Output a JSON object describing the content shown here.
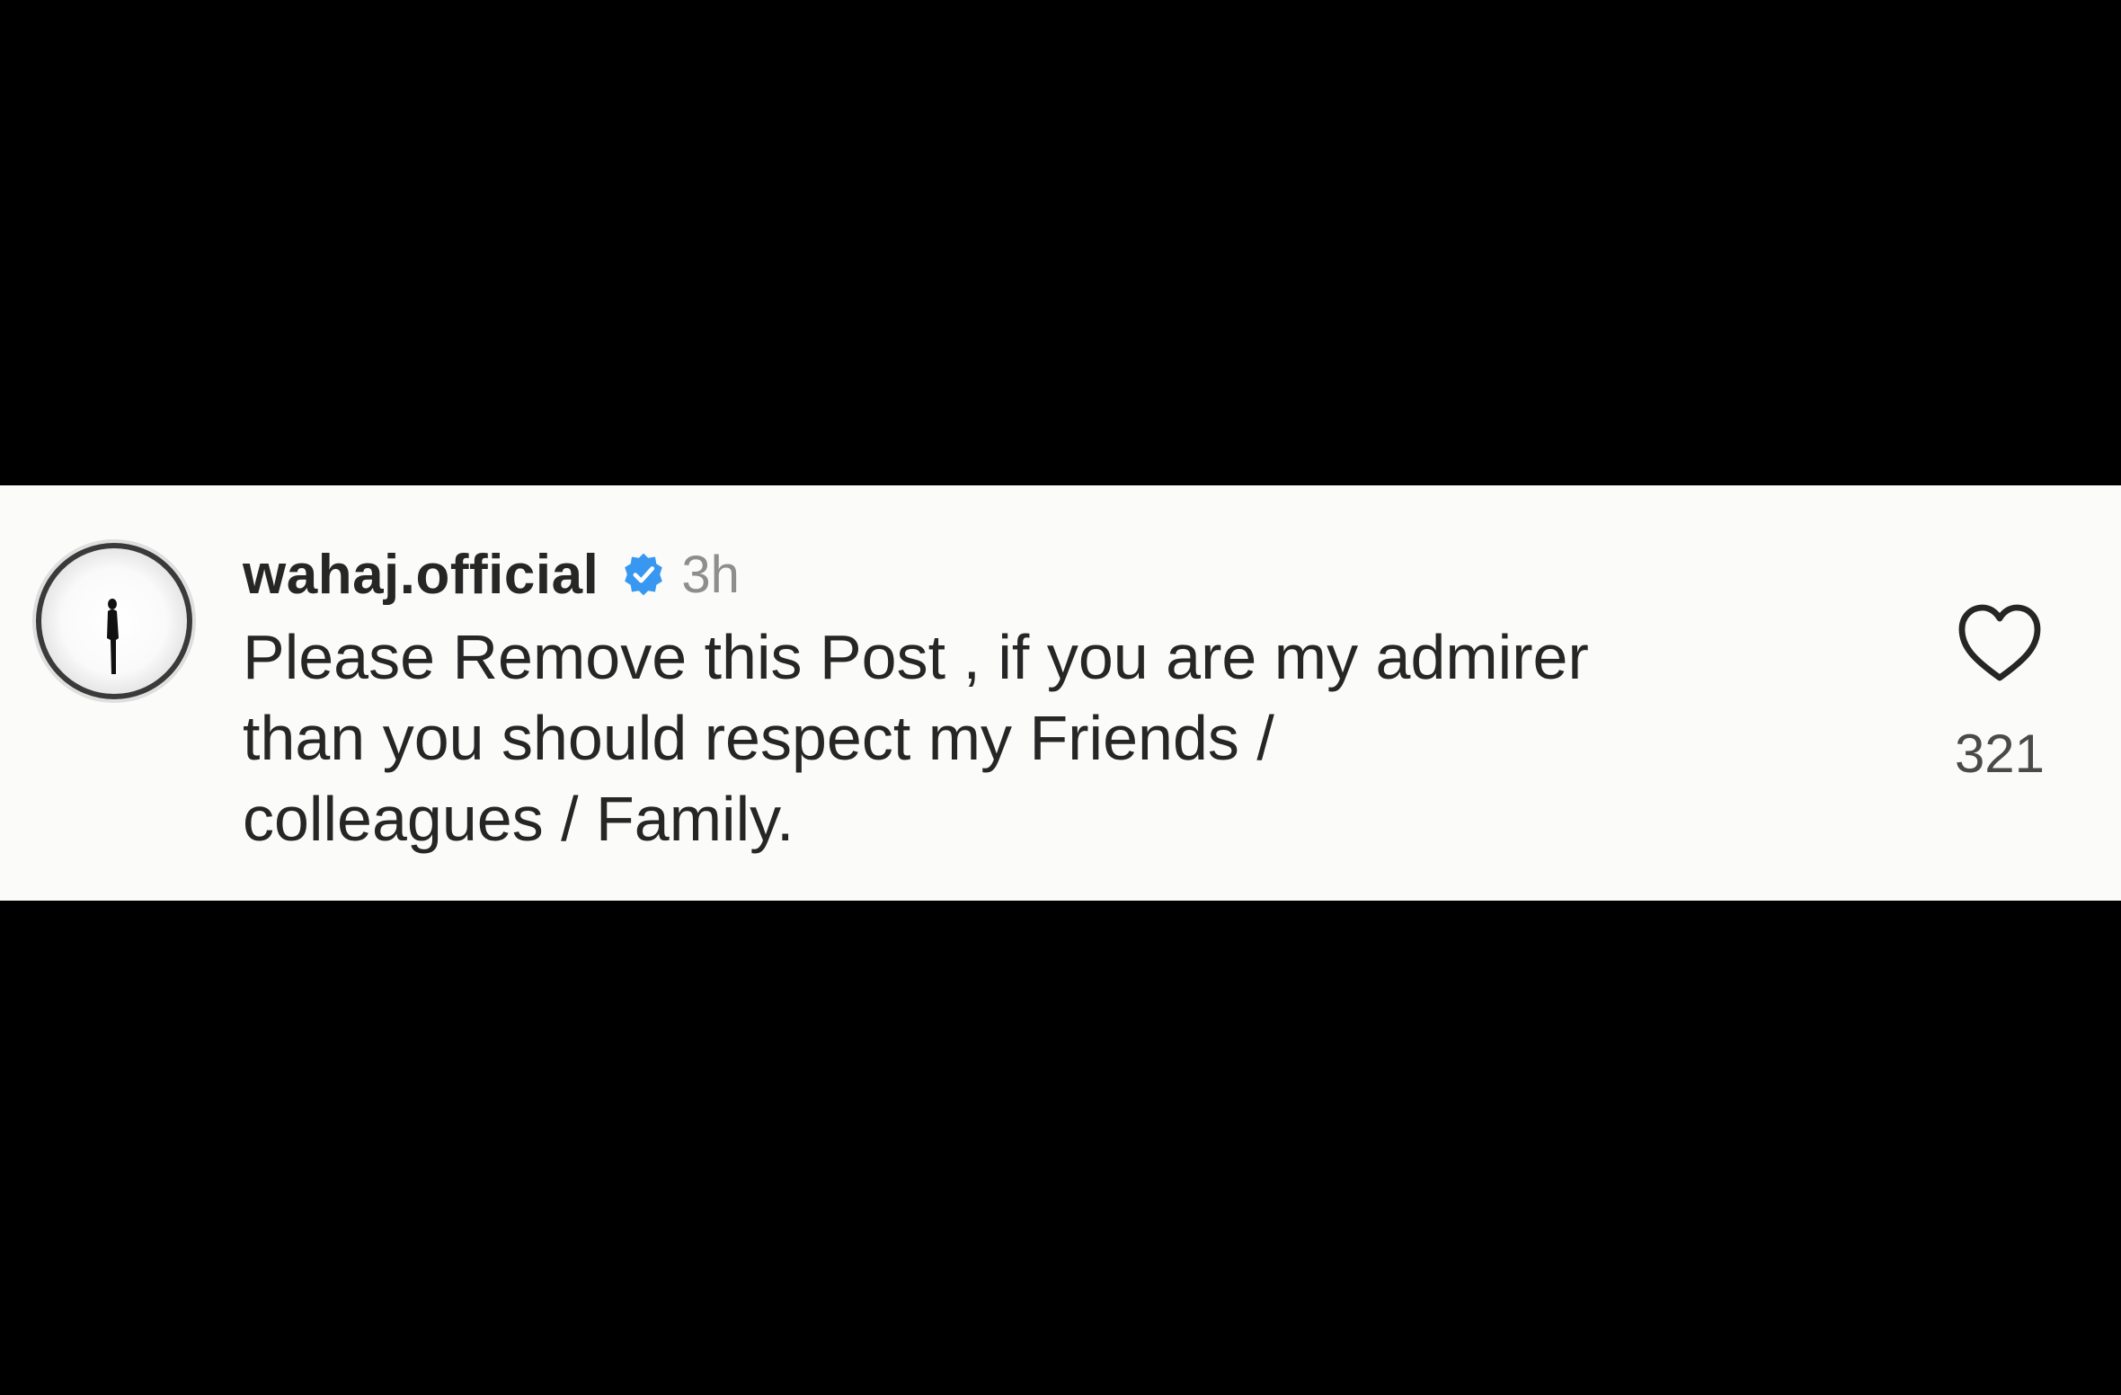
{
  "comment": {
    "username": "wahaj.official",
    "verified": true,
    "timestamp": "3h",
    "text": "Please Remove this Post , if you are my admirer\nthan you should respect my Friends /\ncolleagues / Family.",
    "likes": "321"
  },
  "icons": {
    "avatar": "silhouette-avatar-icon",
    "verified": "verified-badge-icon",
    "like": "heart-icon"
  },
  "colors": {
    "background": "#000000",
    "panel": "#fbfbf9",
    "text": "#262626",
    "muted": "#8e8e8e",
    "verified_blue": "#3897f0"
  }
}
